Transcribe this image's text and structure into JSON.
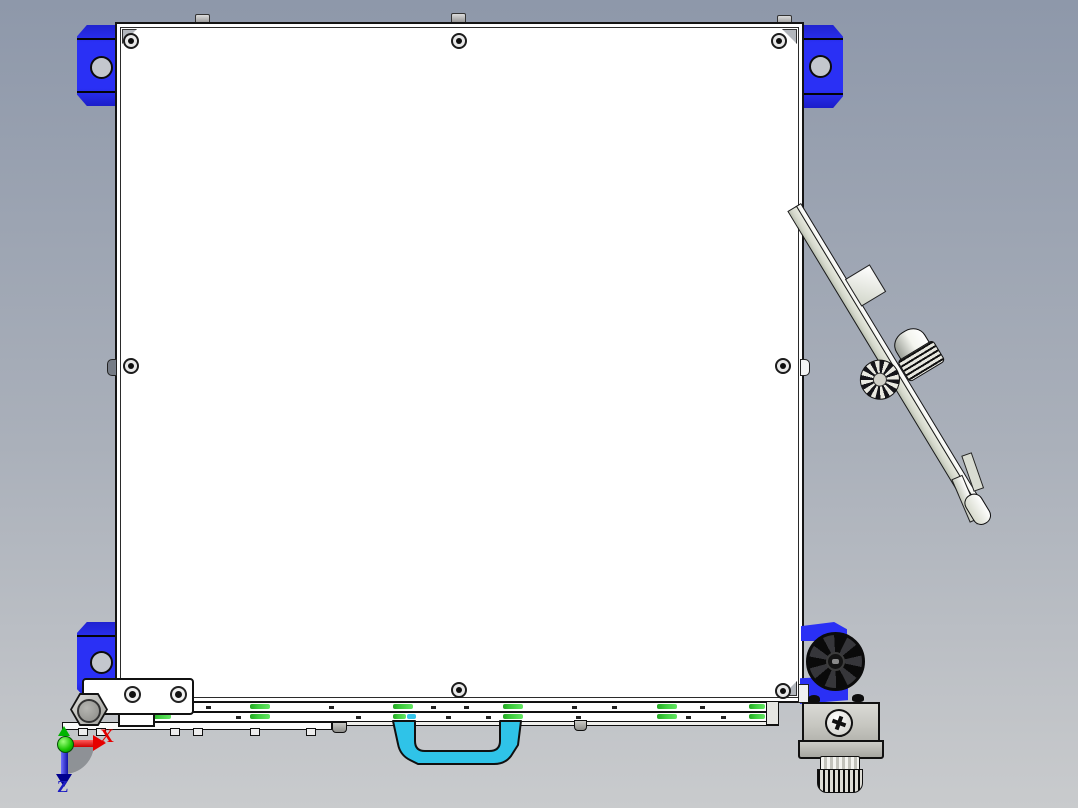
{
  "scene": {
    "axis_triad": {
      "x_label": "X",
      "z_label": "Z"
    },
    "colors": {
      "background_top": "#8e98aa",
      "background_mid": "#aab0ba",
      "background_bottom": "#c9cbcd",
      "panel_white": "#ffffff",
      "bracket_blue": "#2a30f5",
      "bracket_blue_dark": "#1c1ec9",
      "handle_cyan": "#2fc3e8",
      "rail_green": "#3ecc3e",
      "rail_cyan": "#35c5ea",
      "arm_gray": "#d5d8cc",
      "block_gray": "#c6c6c0",
      "wheel_black": "#141414",
      "axis_x_red": "#e60000",
      "axis_y_green": "#00b400",
      "axis_z_blue": "#1c1cc2",
      "origin_green": "#17c400"
    }
  }
}
